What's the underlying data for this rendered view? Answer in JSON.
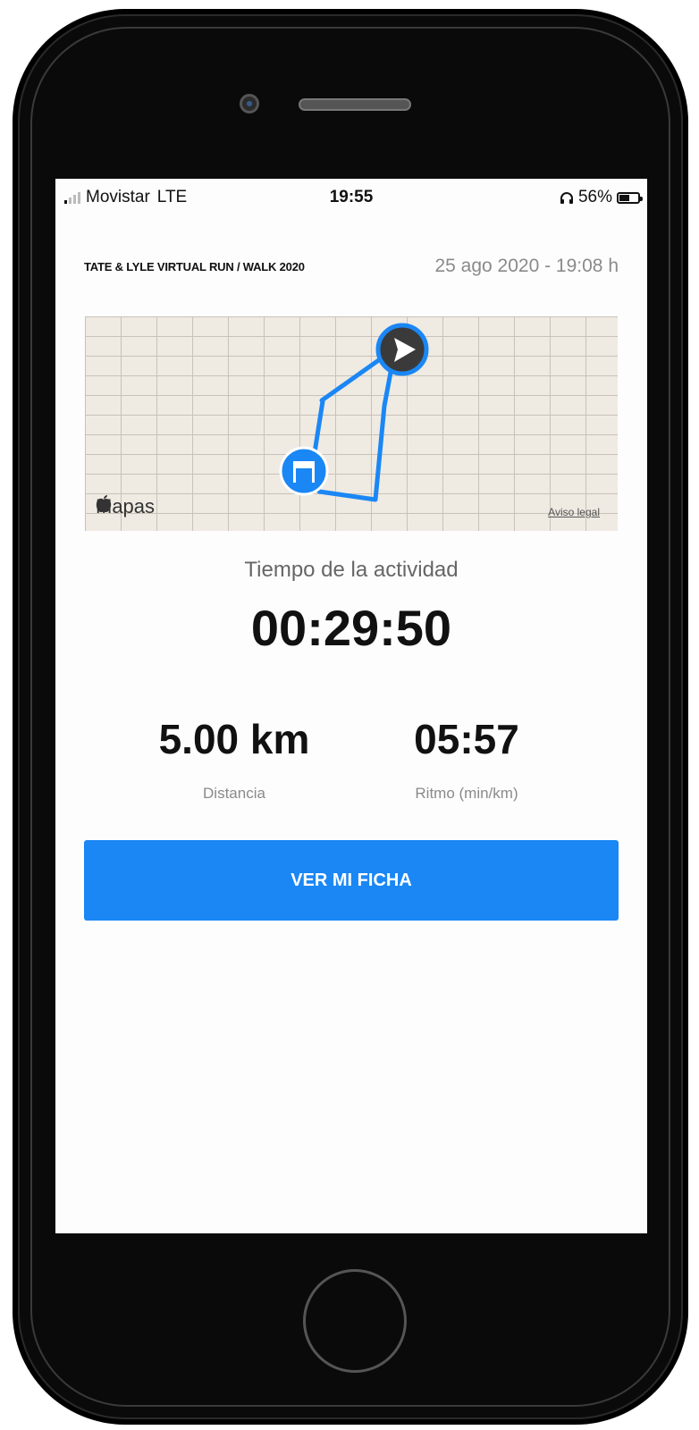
{
  "status_bar": {
    "carrier": "Movistar",
    "network": "LTE",
    "time": "19:55",
    "battery_percent": "56%",
    "battery_level": 0.56,
    "icons": {
      "signal": "signal-bars-icon",
      "headphones": "headphones-icon",
      "battery": "battery-icon"
    }
  },
  "header": {
    "event_title": "TATE & LYLE VIRTUAL RUN / WALK 2020",
    "date_time": "25 ago 2020 - 19:08 h"
  },
  "map": {
    "brand": "Mapas",
    "legal_link": "Aviso legal",
    "route_color": "#1a87f5",
    "icons": {
      "finish": "finish-flag-icon",
      "start": "start-arrow-icon",
      "apple": "apple-icon"
    }
  },
  "activity": {
    "time_label": "Tiempo de la actividad",
    "time_value": "00:29:50"
  },
  "stats": {
    "distance_value": "5.00 km",
    "distance_label": "Distancia",
    "pace_value": "05:57",
    "pace_label": "Ritmo (min/km)"
  },
  "actions": {
    "primary_label": "VER MI FICHA",
    "primary_color": "#1a87f5"
  }
}
